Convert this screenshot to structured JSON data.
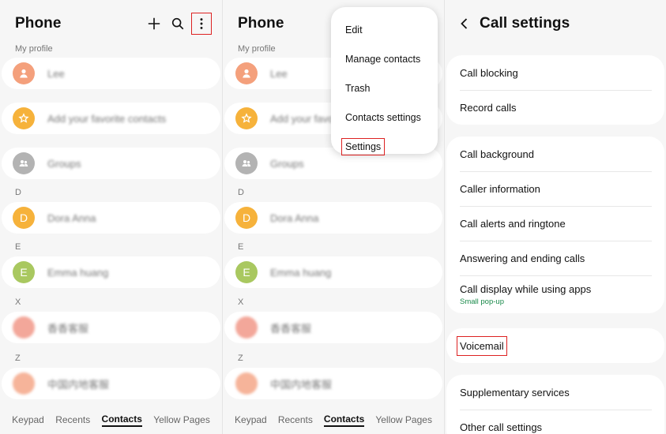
{
  "panel1": {
    "title": "Phone",
    "my_profile_label": "My profile",
    "rows": [
      {
        "name": "Lee",
        "avatar_color": "#f4a07c",
        "avatar_icon": "person-icon"
      },
      {
        "name": "Add your favorite contacts",
        "avatar_color": "#f6b23b",
        "avatar_icon": "star-icon"
      },
      {
        "name": "Groups",
        "avatar_color": "#b3b3b3",
        "avatar_icon": "group-icon"
      }
    ],
    "groups": [
      {
        "letter": "D",
        "contact": {
          "initial": "D",
          "name": "Dora Anna",
          "avatar_color": "#f6b23b"
        }
      },
      {
        "letter": "E",
        "contact": {
          "initial": "E",
          "name": "Emma huang",
          "avatar_color": "#a9c860"
        }
      },
      {
        "letter": "X",
        "contact": {
          "initial": "",
          "name": "香香客服",
          "avatar_color": "#f3a79a"
        }
      },
      {
        "letter": "Z",
        "contact": {
          "initial": "",
          "name": "中国内地客服",
          "avatar_color": "#f6b49a"
        }
      }
    ],
    "bottom_tabs": [
      "Keypad",
      "Recents",
      "Contacts",
      "Yellow Pages"
    ]
  },
  "panel2": {
    "menu": [
      "Edit",
      "Manage contacts",
      "Trash",
      "Contacts settings",
      "Settings"
    ]
  },
  "panel3": {
    "title": "Call settings",
    "group1": [
      "Call blocking",
      "Record calls"
    ],
    "group2": [
      "Call background",
      "Caller information",
      "Call alerts and ringtone",
      "Answering and ending calls",
      "Call display while using apps"
    ],
    "call_display_sub": "Small pop-up",
    "voicemail": "Voicemail",
    "group4": [
      "Supplementary services",
      "Other call settings"
    ]
  },
  "colors": {
    "highlight": "#d22222",
    "accent_green": "#1a8a4a"
  }
}
